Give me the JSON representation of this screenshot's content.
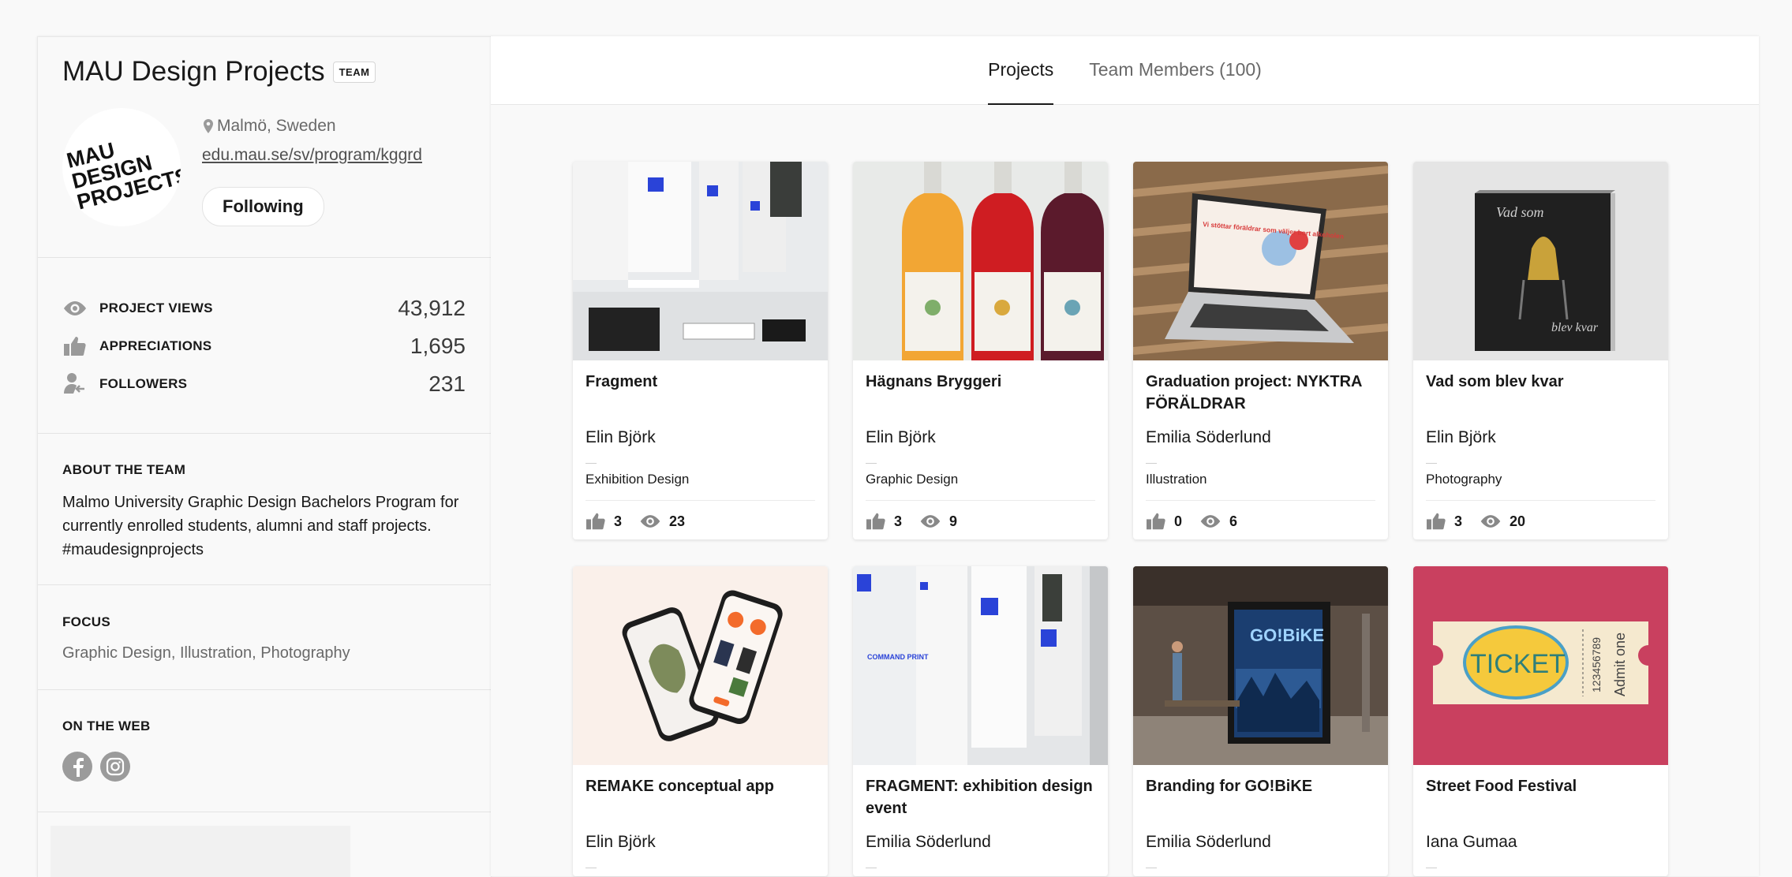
{
  "tabs": [
    {
      "label": "Projects",
      "active": true
    },
    {
      "label": "Team Members (100)",
      "active": false
    }
  ],
  "profile": {
    "name": "MAU Design Projects",
    "badge": "TEAM",
    "logo_text": [
      "MAU",
      "DESIGN",
      "PROJECTS"
    ],
    "location": "Malmö, Sweden",
    "website": "edu.mau.se/sv/program/kggrd",
    "follow_label": "Following"
  },
  "stats": [
    {
      "icon": "eye-icon",
      "label": "PROJECT VIEWS",
      "value": "43,912"
    },
    {
      "icon": "thumbs-up-icon",
      "label": "APPRECIATIONS",
      "value": "1,695"
    },
    {
      "icon": "followers-icon",
      "label": "FOLLOWERS",
      "value": "231"
    }
  ],
  "about": {
    "heading": "ABOUT THE TEAM",
    "text": "Malmo University Graphic Design Bachelors Program for currently enrolled students, alumni and staff projects. #maudesignprojects"
  },
  "focus": {
    "heading": "FOCUS",
    "items": [
      "Graphic Design",
      "Illustration",
      "Photography"
    ],
    "separator": ","
  },
  "web": {
    "heading": "ON THE WEB",
    "links": [
      "facebook-icon",
      "instagram-icon"
    ]
  },
  "projects": [
    {
      "title": "Fragment",
      "owner": "Elin Björk",
      "field": "Exhibition Design",
      "likes": "3",
      "views": "23",
      "thumb": "exhibition"
    },
    {
      "title": "Hägnans Bryggeri",
      "owner": "Elin Björk",
      "field": "Graphic Design",
      "likes": "3",
      "views": "9",
      "thumb": "bottles"
    },
    {
      "title": "Graduation project: NYKTRA FÖRÄLDRAR",
      "owner": "Emilia Söderlund",
      "field": "Illustration",
      "likes": "0",
      "views": "6",
      "thumb": "laptop",
      "screen_text": "Vi stöttar föräldrar som väljer bort alkoholen"
    },
    {
      "title": "Vad som blev kvar",
      "owner": "Elin Björk",
      "field": "Photography",
      "likes": "3",
      "views": "20",
      "thumb": "book",
      "book_title": "Vad som",
      "book_sub": "blev kvar"
    },
    {
      "title": "REMAKE conceptual app",
      "owner": "Elin Björk",
      "field": "",
      "likes": "",
      "views": "",
      "thumb": "phones"
    },
    {
      "title": "FRAGMENT: exhibition design event",
      "owner": "Emilia Söderlund",
      "field": "",
      "likes": "",
      "views": "",
      "thumb": "exhibition2",
      "poster_text": "COMMAND PRINT"
    },
    {
      "title": "Branding for GO!BiKE",
      "owner": "Emilia Söderlund",
      "field": "",
      "likes": "",
      "views": "",
      "thumb": "busstop",
      "poster_text": "GO!BiKE"
    },
    {
      "title": "Street Food Festival",
      "owner": "Iana Gumaa",
      "field": "",
      "likes": "",
      "views": "",
      "thumb": "ticket",
      "ticket_text": "TICKET",
      "ticket_num": "123456789",
      "ticket_admit": "Admit one"
    }
  ]
}
